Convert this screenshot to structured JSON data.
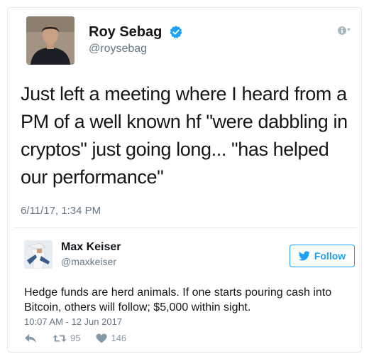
{
  "main_tweet": {
    "author_name": "Roy Sebag",
    "author_handle": "@roysebag",
    "text": "Just left a meeting where I heard from a PM of a well known hf \"were dabbling in cryptos\" just going long... \"has helped our performance\"",
    "timestamp": "6/11/17, 1:34 PM",
    "icons": {
      "verified": "verified-badge-icon",
      "info": "info-icon"
    }
  },
  "quoted_tweet": {
    "author_name": "Max Keiser",
    "author_handle": "@maxkeiser",
    "follow_label": "Follow",
    "text": "Hedge funds are herd animals. If one starts pouring cash into Bitcoin, others will follow; $5,000 within sight.",
    "timestamp": "10:07 AM - 12 Jun 2017",
    "retweets": "95",
    "likes": "146",
    "icons": {
      "follow": "twitter-bird-icon",
      "reply": "reply-icon",
      "retweet": "retweet-icon",
      "like": "heart-icon"
    }
  },
  "colors": {
    "accent": "#1da1f2",
    "text": "#14171a",
    "muted": "#657786",
    "border": "#e1e8ed"
  }
}
